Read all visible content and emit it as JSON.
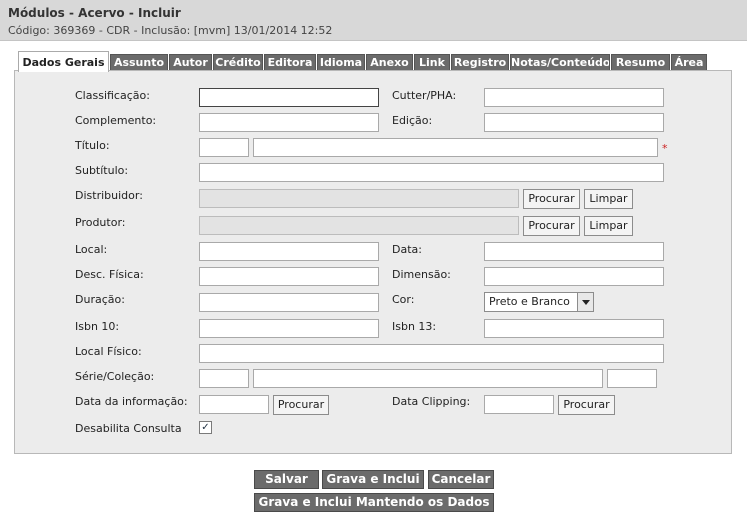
{
  "header": {
    "title": "Módulos - Acervo - Incluir",
    "subtitle": "Código: 369369 - CDR - Inclusão: [mvm] 13/01/2014 12:52"
  },
  "tabs": [
    {
      "label": "Dados Gerais",
      "active": true
    },
    {
      "label": "Assunto"
    },
    {
      "label": "Autor"
    },
    {
      "label": "Crédito"
    },
    {
      "label": "Editora"
    },
    {
      "label": "Idioma"
    },
    {
      "label": "Anexo"
    },
    {
      "label": "Link"
    },
    {
      "label": "Registro"
    },
    {
      "label": "Notas/Conteúdo"
    },
    {
      "label": "Resumo"
    },
    {
      "label": "Área"
    }
  ],
  "form": {
    "classificacao": {
      "label": "Classificação:",
      "value": ""
    },
    "cutter": {
      "label": "Cutter/PHA:",
      "value": ""
    },
    "complemento": {
      "label": "Complemento:",
      "value": ""
    },
    "edicao": {
      "label": "Edição:",
      "value": ""
    },
    "titulo": {
      "label": "Título:",
      "prefix": "",
      "value": "",
      "required_mark": "*"
    },
    "subtitulo": {
      "label": "Subtítulo:",
      "value": ""
    },
    "distribuidor": {
      "label": "Distribuidor:",
      "value": "",
      "search_label": "Procurar",
      "clear_label": "Limpar"
    },
    "produtor": {
      "label": "Produtor:",
      "value": "",
      "search_label": "Procurar",
      "clear_label": "Limpar"
    },
    "local": {
      "label": "Local:",
      "value": ""
    },
    "data": {
      "label": "Data:",
      "value": ""
    },
    "desc_fisica": {
      "label": "Desc. Física:",
      "value": ""
    },
    "dimensao": {
      "label": "Dimensão:",
      "value": ""
    },
    "duracao": {
      "label": "Duração:",
      "value": ""
    },
    "cor": {
      "label": "Cor:",
      "selected": "Preto e Branco"
    },
    "isbn10": {
      "label": "Isbn 10:",
      "value": ""
    },
    "isbn13": {
      "label": "Isbn 13:",
      "value": ""
    },
    "local_fisico": {
      "label": "Local Físico:",
      "value": ""
    },
    "serie": {
      "label": "Série/Coleção:",
      "value1": "",
      "value2": "",
      "value3": ""
    },
    "data_informacao": {
      "label": "Data da informação:",
      "value": "",
      "search_label": "Procurar"
    },
    "data_clipping": {
      "label": "Data Clipping:",
      "value": "",
      "search_label": "Procurar"
    },
    "desabilita": {
      "label": "Desabilita Consulta",
      "checked": true,
      "check_glyph": "✓"
    }
  },
  "actions": {
    "salvar": "Salvar",
    "grava_inclui": "Grava e Inclui",
    "cancelar": "Cancelar",
    "grava_inclui_mantendo": "Grava e Inclui Mantendo os Dados"
  }
}
